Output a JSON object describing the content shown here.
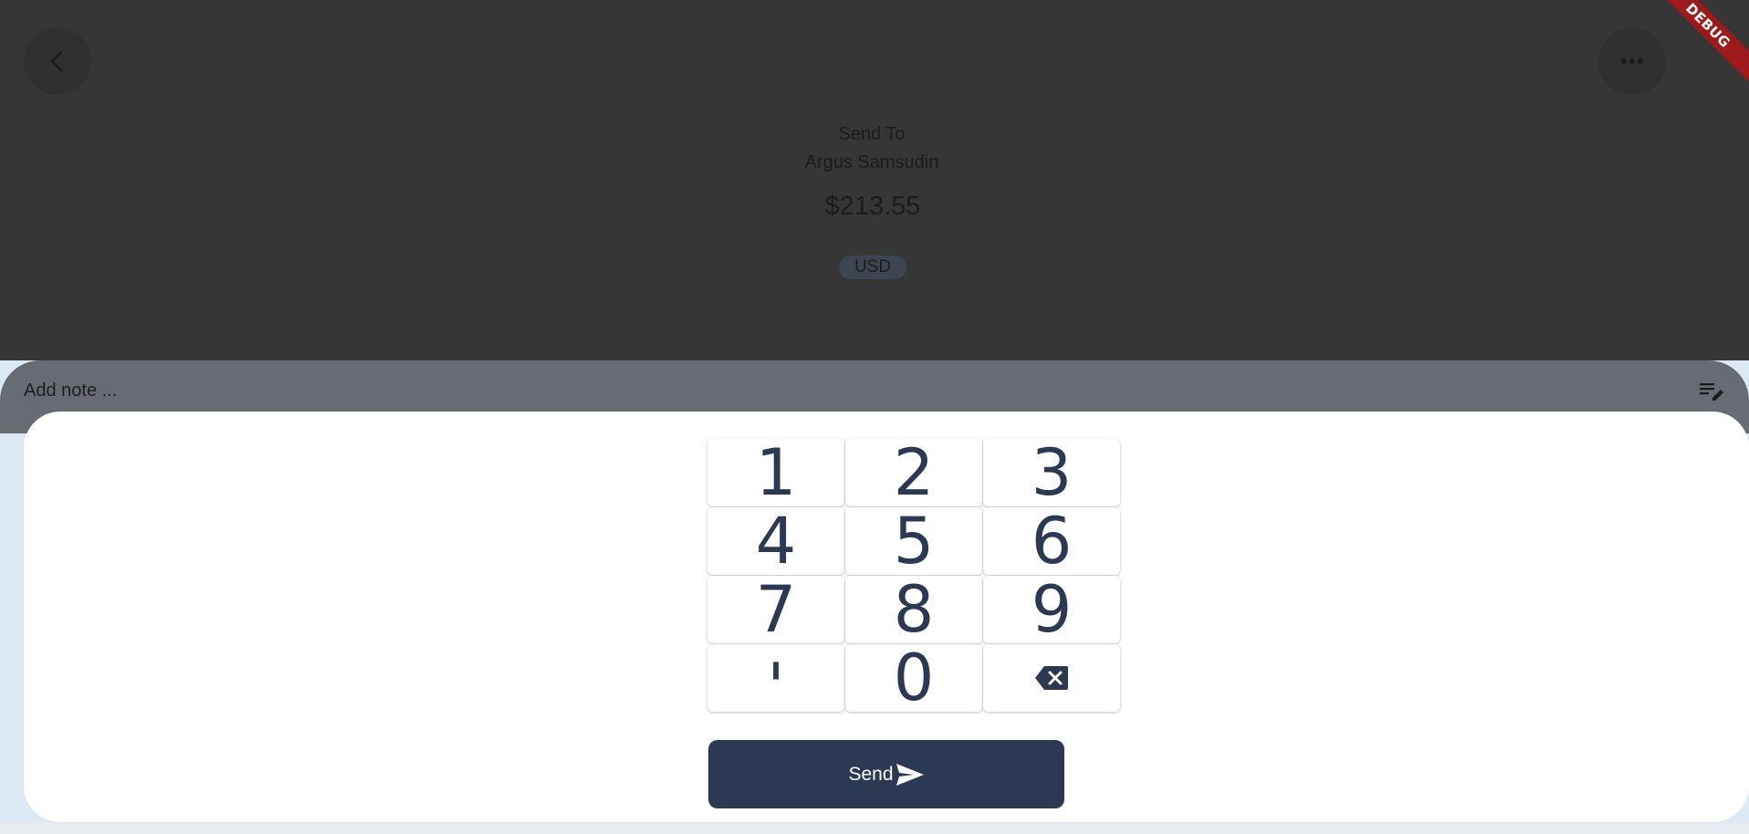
{
  "header": {
    "back_icon": "chevron-left-icon",
    "more_icon": "more-horiz-icon",
    "debug_label": "DEBUG"
  },
  "transfer": {
    "send_to_label": "Send To",
    "recipient": "Argus Samsudin",
    "amount": "$213.55",
    "currency": "USD"
  },
  "note": {
    "placeholder": "Add note ...",
    "icon": "edit-note-icon"
  },
  "keypad": {
    "keys": [
      "1",
      "2",
      "3",
      "4",
      "5",
      "6",
      "7",
      "8",
      "9",
      "'",
      "0"
    ],
    "backspace_icon": "backspace-icon"
  },
  "send_button": {
    "label": "Send",
    "icon": "send-icon"
  },
  "colors": {
    "overlay": "#363636",
    "primary": "#2b3a52",
    "debug": "#9e1a1a",
    "background": "#dde8f5"
  }
}
